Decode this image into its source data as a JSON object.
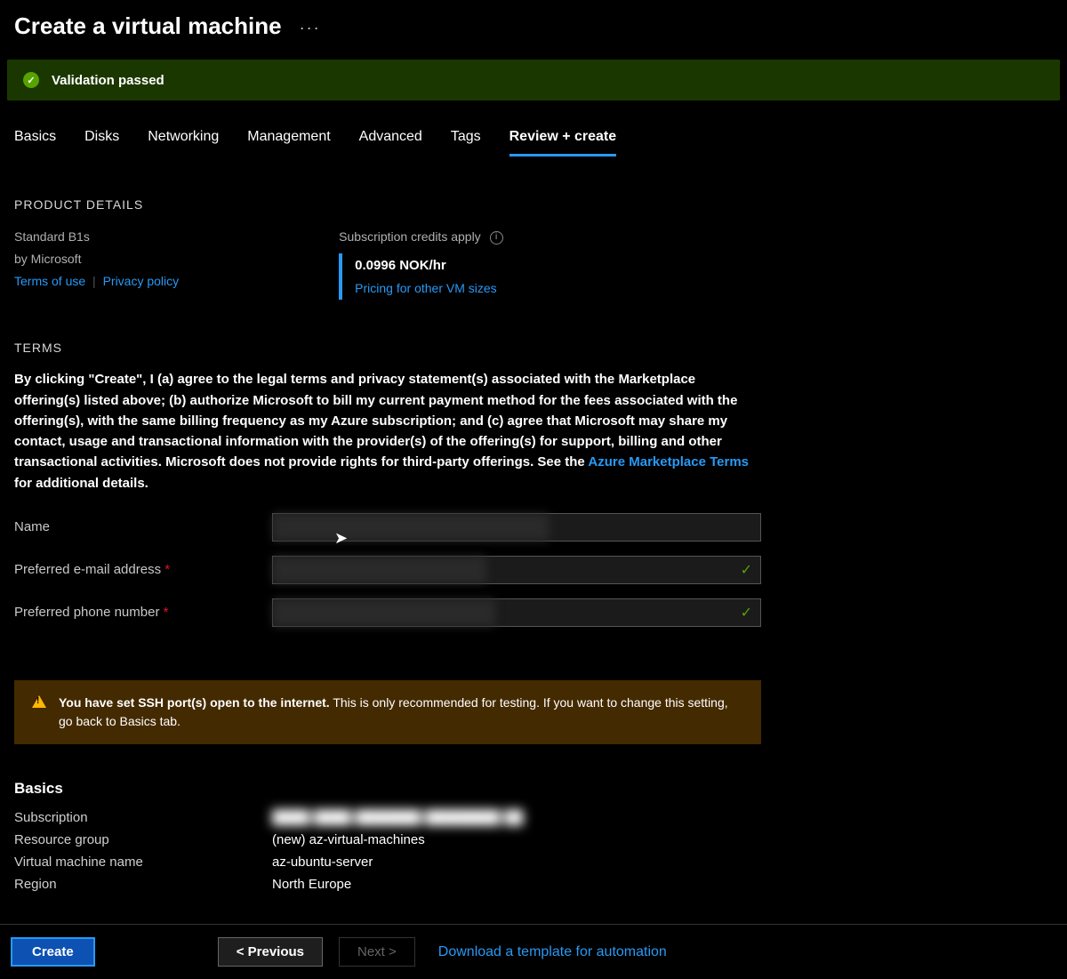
{
  "header": {
    "title": "Create a virtual machine"
  },
  "validation": {
    "text": "Validation passed"
  },
  "tabs": [
    {
      "label": "Basics"
    },
    {
      "label": "Disks"
    },
    {
      "label": "Networking"
    },
    {
      "label": "Management"
    },
    {
      "label": "Advanced"
    },
    {
      "label": "Tags"
    },
    {
      "label": "Review + create",
      "active": true
    }
  ],
  "product": {
    "section_title": "PRODUCT DETAILS",
    "sku": "Standard B1s",
    "vendor": "by Microsoft",
    "terms_link": "Terms of use",
    "privacy_link": "Privacy policy",
    "credits_text": "Subscription credits apply",
    "price": "0.0996 NOK/hr",
    "pricing_link": "Pricing for other VM sizes"
  },
  "terms": {
    "section_title": "TERMS",
    "text_before_link": "By clicking \"Create\", I (a) agree to the legal terms and privacy statement(s) associated with the Marketplace offering(s) listed above; (b) authorize Microsoft to bill my current payment method for the fees associated with the offering(s), with the same billing frequency as my Azure subscription; and (c) agree that Microsoft may share my contact, usage and transactional information with the provider(s) of the offering(s) for support, billing and other transactional activities. Microsoft does not provide rights for third-party offerings. See the ",
    "link": "Azure Marketplace Terms",
    "text_after_link": " for additional details."
  },
  "form": {
    "name_label": "Name",
    "email_label": "Preferred e-mail address",
    "phone_label": "Preferred phone number"
  },
  "warning": {
    "strong": "You have set SSH port(s) open to the internet.",
    "rest": "  This is only recommended for testing.  If you want to change this setting, go back to Basics tab."
  },
  "basics": {
    "title": "Basics",
    "rows": [
      {
        "label": "Subscription",
        "value": "",
        "blurred": true
      },
      {
        "label": "Resource group",
        "value": "(new) az-virtual-machines"
      },
      {
        "label": "Virtual machine name",
        "value": "az-ubuntu-server"
      },
      {
        "label": "Region",
        "value": "North Europe"
      }
    ]
  },
  "footer": {
    "create": "Create",
    "previous": "< Previous",
    "next": "Next >",
    "download": "Download a template for automation"
  }
}
